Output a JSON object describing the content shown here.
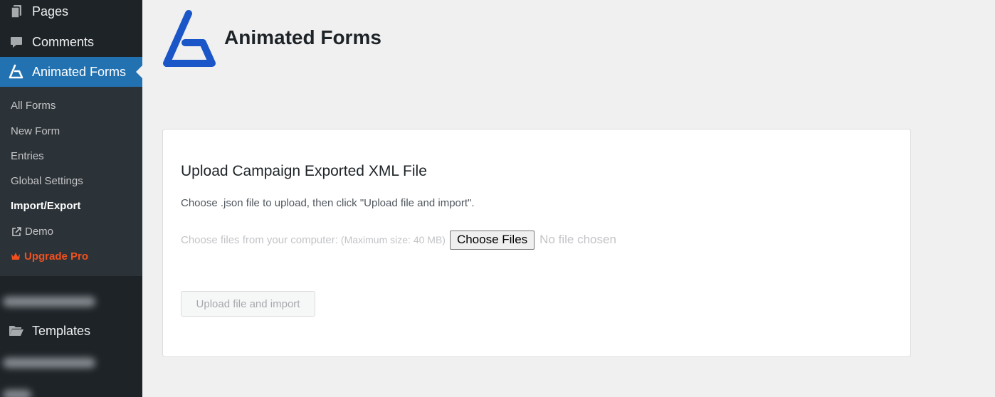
{
  "sidebar": {
    "menu": [
      {
        "label": "Pages",
        "icon": "pages-icon"
      },
      {
        "label": "Comments",
        "icon": "comment-icon"
      },
      {
        "label": "Animated Forms",
        "icon": "animated-forms-icon",
        "active": true
      }
    ],
    "submenu": [
      {
        "label": "All Forms"
      },
      {
        "label": "New Form"
      },
      {
        "label": "Entries"
      },
      {
        "label": "Global Settings"
      },
      {
        "label": "Import/Export",
        "current": true
      },
      {
        "label": "Demo",
        "icon": "external-link-icon"
      },
      {
        "label": "Upgrade Pro",
        "icon": "crown-icon",
        "color": "#f0501e"
      }
    ],
    "templates_label": "Templates",
    "colors": {
      "bg": "#1d2327",
      "submenu_bg": "#2c3338",
      "active": "#2271b1"
    }
  },
  "header": {
    "title": "Animated Forms",
    "logo_color": "#1a56c8"
  },
  "card": {
    "title": "Upload Campaign Exported XML File",
    "description": "Choose .json file to upload, then click \"Upload file and import\".",
    "file_label": "Choose files from your computer:",
    "max_size": "(Maximum size: 40 MB)",
    "choose_button": "Choose Files",
    "no_file_text": "No file chosen",
    "upload_button": "Upload file and import"
  }
}
